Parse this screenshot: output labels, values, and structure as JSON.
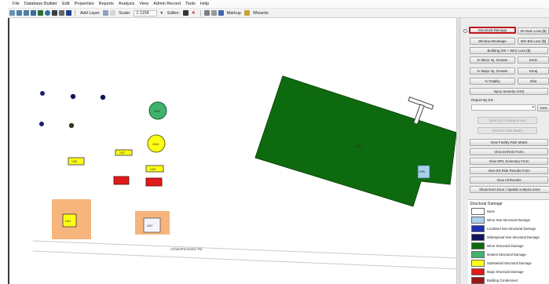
{
  "menu": [
    "File",
    "Database Builder",
    "Edit",
    "Properties",
    "Reports",
    "Analysis",
    "View",
    "Admin Record",
    "Tools",
    "Help"
  ],
  "toolbar": {
    "add_layer_label": "Add Layer",
    "scale_label": "Scale:",
    "scale_value": "1:1158",
    "editor_label": "Editor:",
    "markup_label": "Markup",
    "wizards_label": "Wizards"
  },
  "map": {
    "facility_labels": {
      "big_building": "1001",
      "small_blue_building": "1005",
      "green_circle": "1043",
      "yellow_circle": "1044",
      "yellow_rect_a": "1026",
      "yellow_rect_b": "1027",
      "yellow_rect_c": "1029",
      "orange_square": "1041",
      "orange_inner_white": "1047"
    },
    "road_label": "AirfieldPerimeter Rd",
    "colors": {
      "green_dark": "#0e6a0e",
      "green_circle": "#3fb36b",
      "navy": "#1a1f6e",
      "yellow": "#ffff14",
      "red": "#e01b1b",
      "orange": "#f6b57c",
      "light_blue": "#a8d3ee"
    }
  },
  "panel": {
    "buttons_row1": [
      "Structural Damage",
      "Str Dam Loss ($)"
    ],
    "buttons_row2": [
      "Window Breakage",
      "Win Brk Loss ($)"
    ],
    "buttons_row3": [
      "Building (Str + Win) Loss ($)"
    ],
    "buttons_row4": [
      "% Minor Inj. Greater",
      "Emin"
    ],
    "buttons_row5": [
      "% Major Inj. Greater",
      "Emaj"
    ],
    "buttons_row6": [
      "% Fatality",
      "Efat"
    ],
    "injury_severity": "Injury Severity (AIS)",
    "report_by_es_label": "Report By ES",
    "view_button": "View",
    "view_es_consequences": "View ES Consequences",
    "view_es_risk_matrix": "View ES Risk Matrix",
    "lower_buttons": [
      "View Facility Risk Matrix",
      "View DARAD Form",
      "View MPL Summary Form",
      "View ES Risk Results Form",
      "View All Results",
      "Show Exet Zone / Spatial Analysis Zone"
    ]
  },
  "legend": {
    "title": "Structural Damage",
    "items": [
      {
        "label": "None",
        "color": "#ffffff"
      },
      {
        "label": "Minor Non-structural Damage",
        "color": "#a8d3ee"
      },
      {
        "label": "Localized Non-structural Damage",
        "color": "#1f2fb0"
      },
      {
        "label": "Widespread Non-structural Damage",
        "color": "#10145a"
      },
      {
        "label": "Minor Structural Damage",
        "color": "#0e6a0e"
      },
      {
        "label": "Modest Structural Damage",
        "color": "#3fb36b"
      },
      {
        "label": "Substantial Structural Damage",
        "color": "#ffff14"
      },
      {
        "label": "Major Structural Damage",
        "color": "#e01b1b"
      },
      {
        "label": "Building Condemned",
        "color": "#9b1515"
      }
    ]
  }
}
